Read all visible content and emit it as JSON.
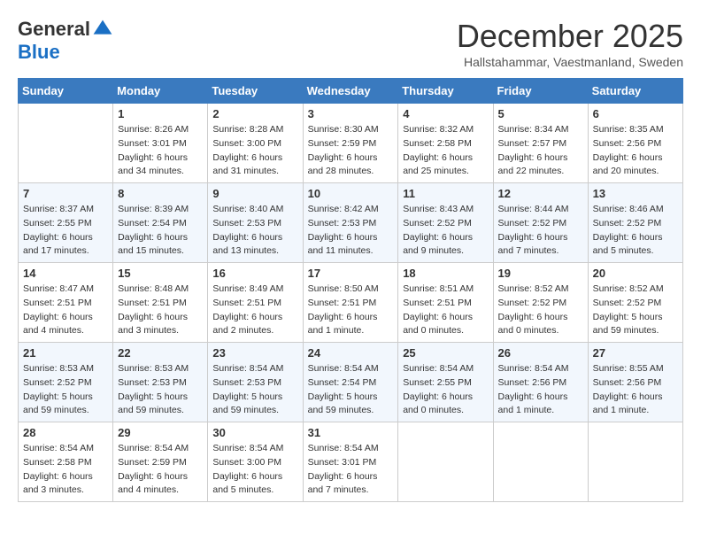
{
  "logo": {
    "general": "General",
    "blue": "Blue"
  },
  "title": "December 2025",
  "subtitle": "Hallstahammar, Vaestmanland, Sweden",
  "weekdays": [
    "Sunday",
    "Monday",
    "Tuesday",
    "Wednesday",
    "Thursday",
    "Friday",
    "Saturday"
  ],
  "weeks": [
    [
      {
        "day": "",
        "info": ""
      },
      {
        "day": "1",
        "info": "Sunrise: 8:26 AM\nSunset: 3:01 PM\nDaylight: 6 hours\nand 34 minutes."
      },
      {
        "day": "2",
        "info": "Sunrise: 8:28 AM\nSunset: 3:00 PM\nDaylight: 6 hours\nand 31 minutes."
      },
      {
        "day": "3",
        "info": "Sunrise: 8:30 AM\nSunset: 2:59 PM\nDaylight: 6 hours\nand 28 minutes."
      },
      {
        "day": "4",
        "info": "Sunrise: 8:32 AM\nSunset: 2:58 PM\nDaylight: 6 hours\nand 25 minutes."
      },
      {
        "day": "5",
        "info": "Sunrise: 8:34 AM\nSunset: 2:57 PM\nDaylight: 6 hours\nand 22 minutes."
      },
      {
        "day": "6",
        "info": "Sunrise: 8:35 AM\nSunset: 2:56 PM\nDaylight: 6 hours\nand 20 minutes."
      }
    ],
    [
      {
        "day": "7",
        "info": "Sunrise: 8:37 AM\nSunset: 2:55 PM\nDaylight: 6 hours\nand 17 minutes."
      },
      {
        "day": "8",
        "info": "Sunrise: 8:39 AM\nSunset: 2:54 PM\nDaylight: 6 hours\nand 15 minutes."
      },
      {
        "day": "9",
        "info": "Sunrise: 8:40 AM\nSunset: 2:53 PM\nDaylight: 6 hours\nand 13 minutes."
      },
      {
        "day": "10",
        "info": "Sunrise: 8:42 AM\nSunset: 2:53 PM\nDaylight: 6 hours\nand 11 minutes."
      },
      {
        "day": "11",
        "info": "Sunrise: 8:43 AM\nSunset: 2:52 PM\nDaylight: 6 hours\nand 9 minutes."
      },
      {
        "day": "12",
        "info": "Sunrise: 8:44 AM\nSunset: 2:52 PM\nDaylight: 6 hours\nand 7 minutes."
      },
      {
        "day": "13",
        "info": "Sunrise: 8:46 AM\nSunset: 2:52 PM\nDaylight: 6 hours\nand 5 minutes."
      }
    ],
    [
      {
        "day": "14",
        "info": "Sunrise: 8:47 AM\nSunset: 2:51 PM\nDaylight: 6 hours\nand 4 minutes."
      },
      {
        "day": "15",
        "info": "Sunrise: 8:48 AM\nSunset: 2:51 PM\nDaylight: 6 hours\nand 3 minutes."
      },
      {
        "day": "16",
        "info": "Sunrise: 8:49 AM\nSunset: 2:51 PM\nDaylight: 6 hours\nand 2 minutes."
      },
      {
        "day": "17",
        "info": "Sunrise: 8:50 AM\nSunset: 2:51 PM\nDaylight: 6 hours\nand 1 minute."
      },
      {
        "day": "18",
        "info": "Sunrise: 8:51 AM\nSunset: 2:51 PM\nDaylight: 6 hours\nand 0 minutes."
      },
      {
        "day": "19",
        "info": "Sunrise: 8:52 AM\nSunset: 2:52 PM\nDaylight: 6 hours\nand 0 minutes."
      },
      {
        "day": "20",
        "info": "Sunrise: 8:52 AM\nSunset: 2:52 PM\nDaylight: 5 hours\nand 59 minutes."
      }
    ],
    [
      {
        "day": "21",
        "info": "Sunrise: 8:53 AM\nSunset: 2:52 PM\nDaylight: 5 hours\nand 59 minutes."
      },
      {
        "day": "22",
        "info": "Sunrise: 8:53 AM\nSunset: 2:53 PM\nDaylight: 5 hours\nand 59 minutes."
      },
      {
        "day": "23",
        "info": "Sunrise: 8:54 AM\nSunset: 2:53 PM\nDaylight: 5 hours\nand 59 minutes."
      },
      {
        "day": "24",
        "info": "Sunrise: 8:54 AM\nSunset: 2:54 PM\nDaylight: 5 hours\nand 59 minutes."
      },
      {
        "day": "25",
        "info": "Sunrise: 8:54 AM\nSunset: 2:55 PM\nDaylight: 6 hours\nand 0 minutes."
      },
      {
        "day": "26",
        "info": "Sunrise: 8:54 AM\nSunset: 2:56 PM\nDaylight: 6 hours\nand 1 minute."
      },
      {
        "day": "27",
        "info": "Sunrise: 8:55 AM\nSunset: 2:56 PM\nDaylight: 6 hours\nand 1 minute."
      }
    ],
    [
      {
        "day": "28",
        "info": "Sunrise: 8:54 AM\nSunset: 2:58 PM\nDaylight: 6 hours\nand 3 minutes."
      },
      {
        "day": "29",
        "info": "Sunrise: 8:54 AM\nSunset: 2:59 PM\nDaylight: 6 hours\nand 4 minutes."
      },
      {
        "day": "30",
        "info": "Sunrise: 8:54 AM\nSunset: 3:00 PM\nDaylight: 6 hours\nand 5 minutes."
      },
      {
        "day": "31",
        "info": "Sunrise: 8:54 AM\nSunset: 3:01 PM\nDaylight: 6 hours\nand 7 minutes."
      },
      {
        "day": "",
        "info": ""
      },
      {
        "day": "",
        "info": ""
      },
      {
        "day": "",
        "info": ""
      }
    ]
  ]
}
